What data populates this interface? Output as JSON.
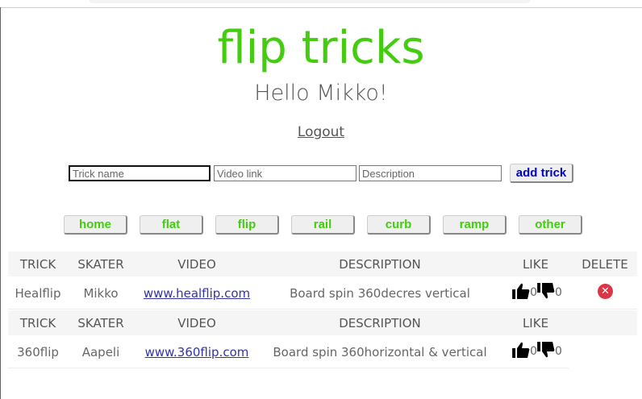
{
  "title": "flip tricks",
  "greeting": "Hello Mikko!",
  "logout": "Logout",
  "form": {
    "trick_placeholder": "Trick name",
    "video_placeholder": "Video link",
    "description_placeholder": "Description",
    "add_label": "add trick"
  },
  "nav": [
    "home",
    "flat",
    "flip",
    "rail",
    "curb",
    "ramp",
    "other"
  ],
  "headers": {
    "trick": "TRICK",
    "skater": "SKATER",
    "video": "VIDEO",
    "description": "DESCRIPTION",
    "like": "LIKE",
    "delete": "DELETE"
  },
  "rows": [
    {
      "trick": "Healflip",
      "skater": "Mikko",
      "video": "www.healflip.com",
      "description": "Board spin 360decres vertical",
      "likes": "0",
      "dislikes": "0",
      "deletable": true
    },
    {
      "trick": "360flip",
      "skater": "Aapeli",
      "video": "www.360flip.com",
      "description": "Board spin 360horizontal & vertical",
      "likes": "0",
      "dislikes": "0",
      "deletable": false
    }
  ],
  "colors": {
    "accent": "#44cc11",
    "button_text": "#0000cc",
    "delete": "#dc3545"
  }
}
